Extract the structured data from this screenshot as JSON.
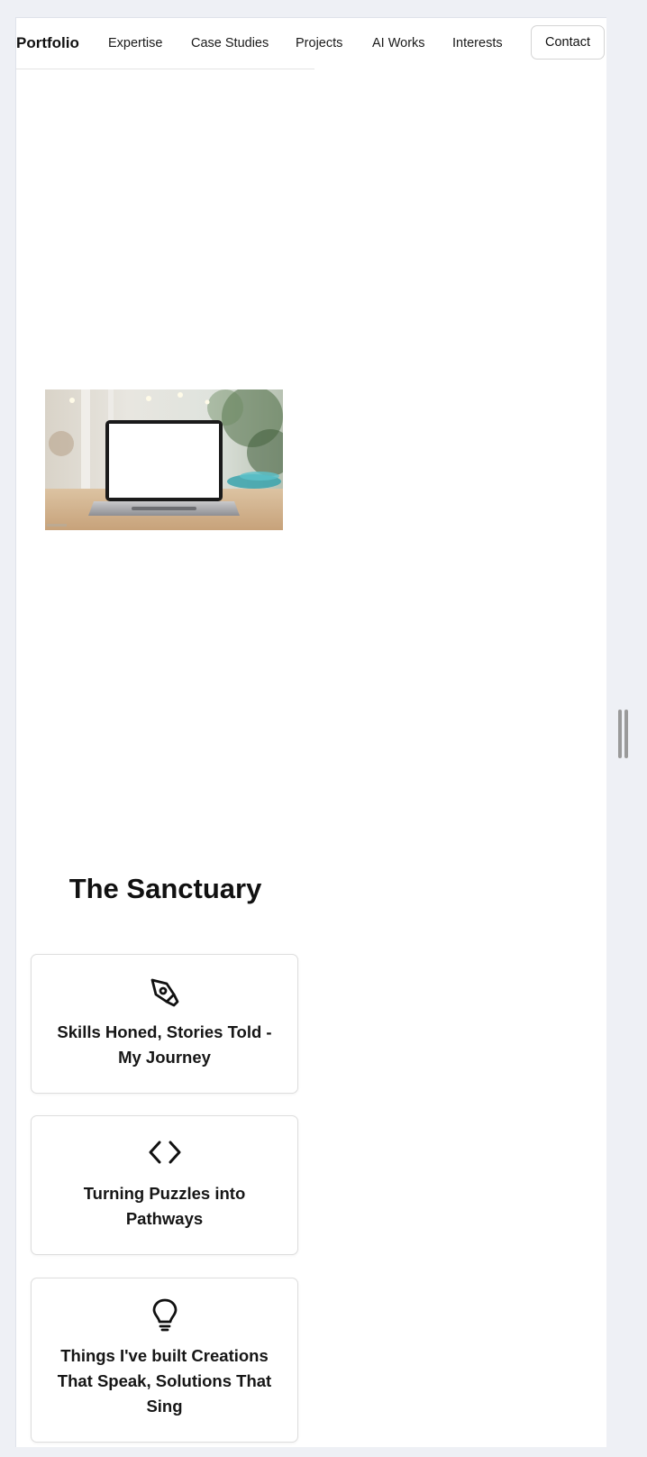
{
  "nav": {
    "brand": "Portfolio",
    "links": [
      {
        "label": "Expertise"
      },
      {
        "label": "Case Studies"
      },
      {
        "label": "Projects"
      },
      {
        "label": "AI Works"
      },
      {
        "label": "Interests"
      }
    ],
    "contact_label": "Contact"
  },
  "hero": {
    "image": "laptop-on-desk-photo"
  },
  "sanctuary": {
    "title": "The Sanctuary",
    "cards": [
      {
        "icon": "pen-nib-icon",
        "text": "Skills Honed, Stories Told - My Journey"
      },
      {
        "icon": "code-icon",
        "text": "Turning Puzzles into Pathways"
      },
      {
        "icon": "lightbulb-icon",
        "text": "Things I've built Creations That Speak, Solutions That Sing"
      }
    ]
  },
  "colors": {
    "page_bg": "#ffffff",
    "outer_bg": "#eef0f5",
    "text": "#111111",
    "border": "#dddddd"
  }
}
